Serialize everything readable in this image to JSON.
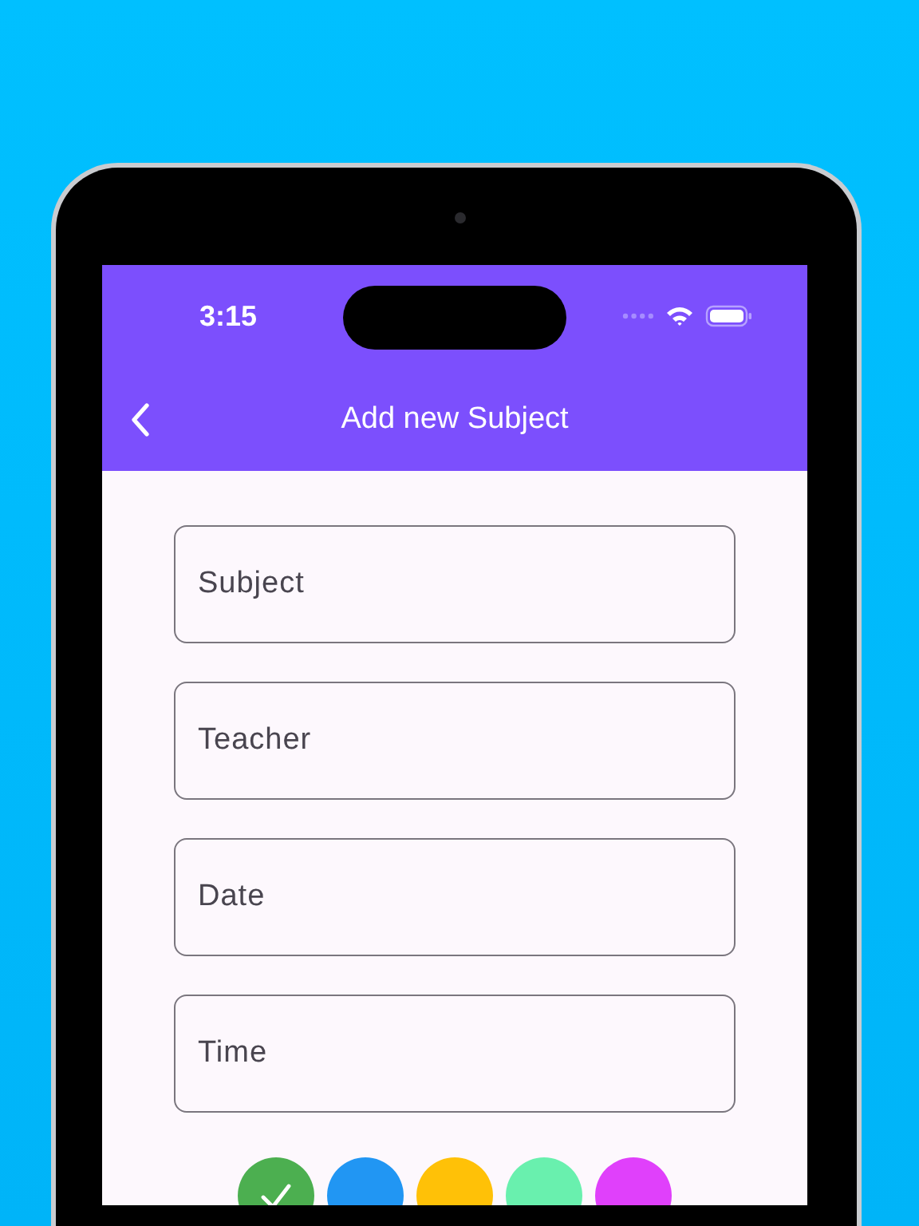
{
  "status_bar": {
    "time": "3:15"
  },
  "app_bar": {
    "title": "Add new Subject"
  },
  "fields": [
    {
      "placeholder": "Subject"
    },
    {
      "placeholder": "Teacher"
    },
    {
      "placeholder": "Date"
    },
    {
      "placeholder": "Time"
    }
  ],
  "colors": [
    {
      "color": "#4caf50",
      "selected": true
    },
    {
      "color": "#2196f3",
      "selected": false
    },
    {
      "color": "#ffc107",
      "selected": false
    },
    {
      "color": "#69f0ae",
      "selected": false
    },
    {
      "color": "#e040fb",
      "selected": false
    }
  ]
}
